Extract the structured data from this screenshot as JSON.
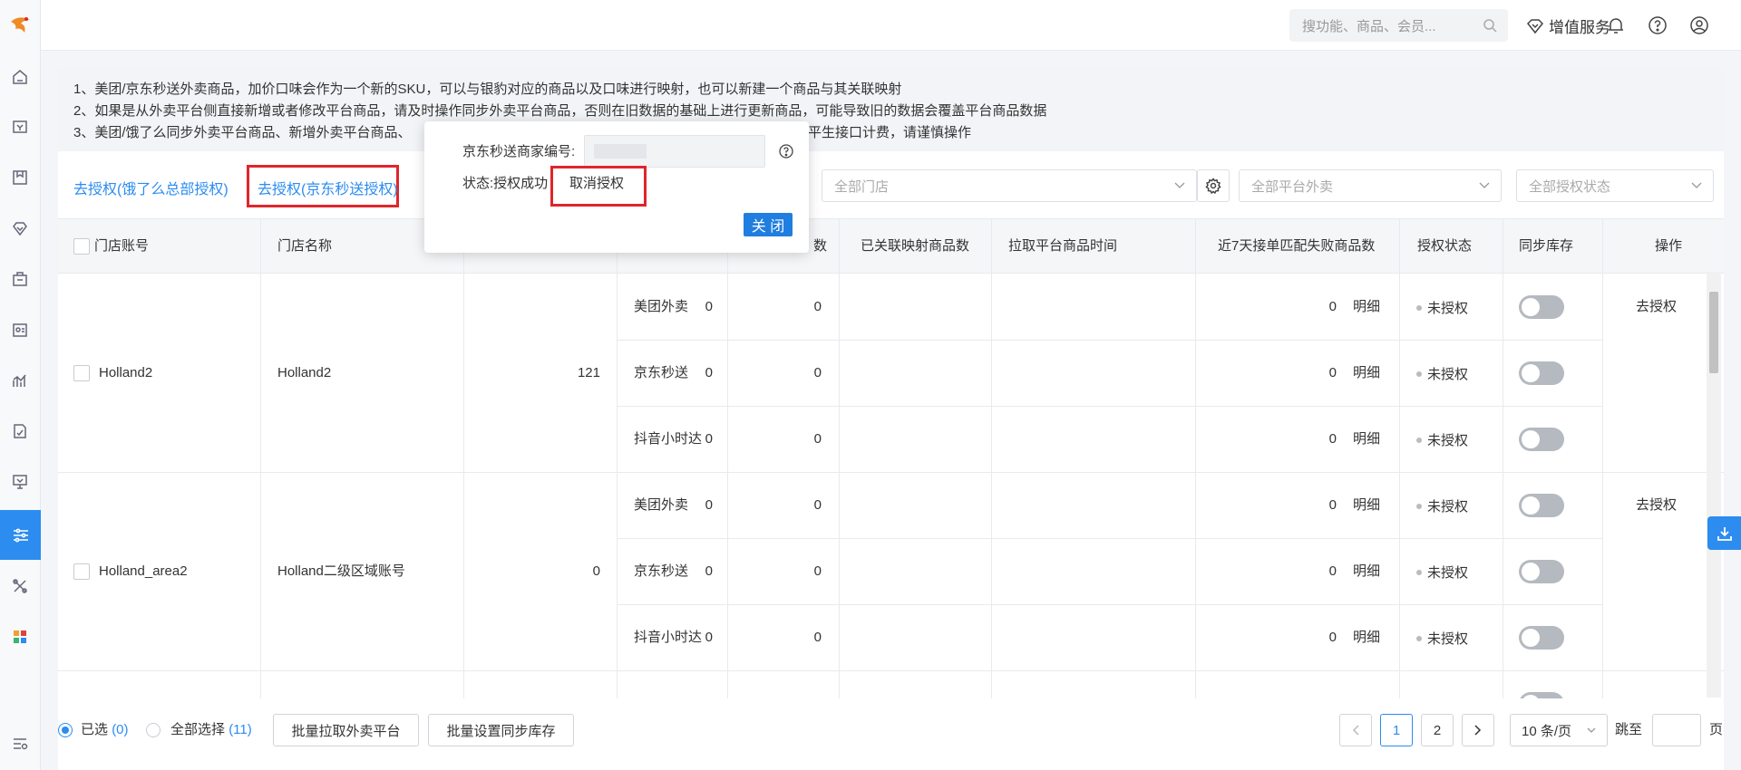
{
  "topbar": {
    "search_placeholder": "搜功能、商品、会员...",
    "vip_label": "增值服务"
  },
  "notice": {
    "lines": [
      "1、美团/京东秒送外卖商品，加价口味会作为一个新的SKU，可以与银豹对应的商品以及口味进行映射，也可以新建一个商品与其关联映射",
      "2、如果是从外卖平台侧直接新增或者修改平台商品，请及时操作同步外卖平台商品，否则在旧数据的基础上进行更新商品，可能导致旧的数据会覆盖平台商品数据",
      "3、美团/饿了么同步外卖平台商品、新增外卖平台商品、",
      "平生接口计费，请谨慎操作"
    ]
  },
  "filter": {
    "auth_eleme": "去授权(饿了么总部授权)",
    "auth_jd": "去授权(京东秒送授权)",
    "store_select": "全部门店",
    "platform_select": "全部平台外卖",
    "auth_status_select": "全部授权状态"
  },
  "popover": {
    "merchant_label": "京东秒送商家编号:",
    "status_label": "状态:授权成功",
    "cancel_auth": "取消授权",
    "close": "关 闭"
  },
  "table": {
    "headers": {
      "account": "门店账号",
      "name": "门店名称",
      "goods_count": "数",
      "platform": "",
      "mapped_count": "已关联映射商品数",
      "pull_time": "拉取平台商品时间",
      "fail_count": "近7天接单匹配失败商品数",
      "auth_status": "授权状态",
      "sync_stock": "同步库存",
      "action": "操作"
    },
    "detail_label": "明细",
    "status_label": "未授权",
    "go_auth_label": "去授权",
    "groups": [
      {
        "account": "Holland2",
        "name": "Holland2",
        "goods_count": "121",
        "rows": [
          {
            "platform": "美团外卖",
            "c1": "0",
            "c2": "0",
            "c3": "0"
          },
          {
            "platform": "京东秒送",
            "c1": "0",
            "c2": "0",
            "c3": "0"
          },
          {
            "platform": "抖音小时达",
            "c1": "0",
            "c2": "0",
            "c3": "0"
          }
        ]
      },
      {
        "account": "Holland_area2",
        "name": "Holland二级区域账号",
        "goods_count": "0",
        "rows": [
          {
            "platform": "美团外卖",
            "c1": "0",
            "c2": "0",
            "c3": "0"
          },
          {
            "platform": "京东秒送",
            "c1": "0",
            "c2": "0",
            "c3": "0"
          },
          {
            "platform": "抖音小时达",
            "c1": "0",
            "c2": "0",
            "c3": "0"
          }
        ]
      }
    ]
  },
  "footer": {
    "selected_label": "已选",
    "selected_count": "(0)",
    "select_all_label": "全部选择",
    "select_all_count": "(11)",
    "batch_pull": "批量拉取外卖平台",
    "batch_sync": "批量设置同步库存",
    "page_1": "1",
    "page_2": "2",
    "page_size": "10 条/页",
    "jump_label": "跳至",
    "page_suffix": "页"
  },
  "colors": {
    "accent": "#2c8cf0",
    "highlight_border": "#e0252b"
  }
}
